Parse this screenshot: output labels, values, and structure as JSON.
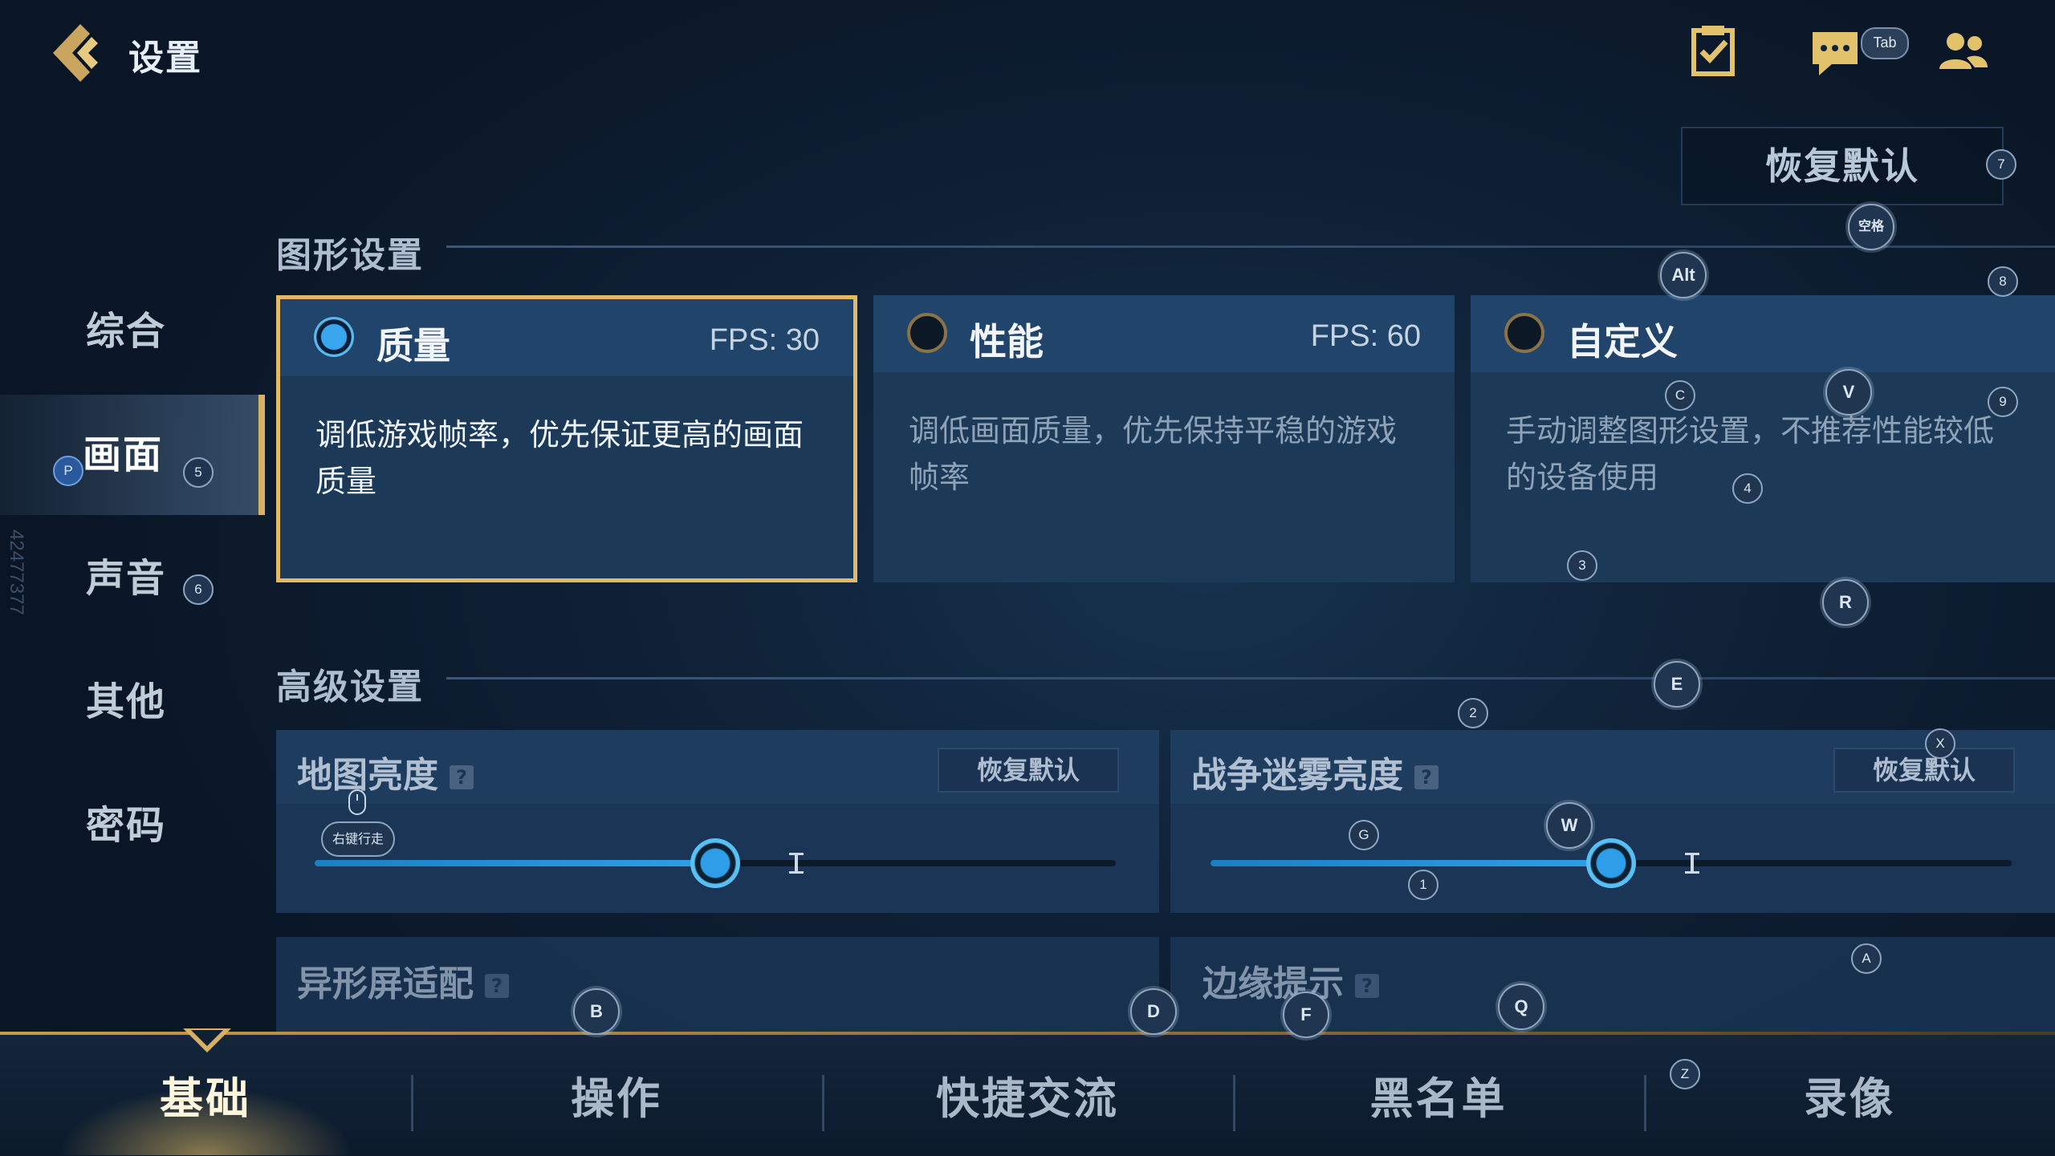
{
  "header": {
    "title": "设置",
    "tab_badge": "Tab",
    "reset_all": "恢复默认"
  },
  "nav": {
    "items": [
      {
        "label": "综合"
      },
      {
        "label": "画面"
      },
      {
        "label": "声音"
      },
      {
        "label": "其他"
      },
      {
        "label": "密码"
      }
    ],
    "active": "画面"
  },
  "graphics": {
    "section_title": "图形设置",
    "cards": [
      {
        "title": "质量",
        "fps": "FPS: 30",
        "desc": "调低游戏帧率，优先保证更高的画面质量",
        "selected": true
      },
      {
        "title": "性能",
        "fps": "FPS: 60",
        "desc": "调低画面质量，优先保持平稳的游戏帧率",
        "selected": false
      },
      {
        "title": "自定义",
        "fps": "",
        "desc": "手动调整图形设置，不推荐性能较低的设备使用",
        "selected": false
      }
    ]
  },
  "advanced": {
    "section_title": "高级设置",
    "map_brightness": {
      "label": "地图亮度",
      "reset": "恢复默认",
      "value": 0.5
    },
    "fog_brightness": {
      "label": "战争迷雾亮度",
      "reset": "恢复默认",
      "value": 0.5
    },
    "notch": {
      "label": "异形屏适配"
    },
    "edge_hint": {
      "label": "边缘提示"
    }
  },
  "bottom_tabs": [
    {
      "label": "基础"
    },
    {
      "label": "操作"
    },
    {
      "label": "快捷交流"
    },
    {
      "label": "黑名单"
    },
    {
      "label": "录像"
    }
  ],
  "key_hints": {
    "p": "P",
    "n5": "5",
    "n6": "6",
    "n7": "7",
    "n8": "8",
    "n9": "9",
    "space": "空格",
    "alt": "Alt",
    "c": "C",
    "v": "V",
    "n4": "4",
    "n3": "3",
    "r": "R",
    "e": "E",
    "n2": "2",
    "x": "X",
    "w": "W",
    "g": "G",
    "n1": "1",
    "a": "A",
    "b": "B",
    "d": "D",
    "f": "F",
    "q": "Q",
    "z": "Z",
    "mouse": "右键行走"
  },
  "watermark": "42477377",
  "colors": {
    "accent_gold": "#d7b063",
    "slider_blue": "#2fa0e6",
    "card_bg": "#1c3958",
    "page_bg": "#0f2238"
  }
}
